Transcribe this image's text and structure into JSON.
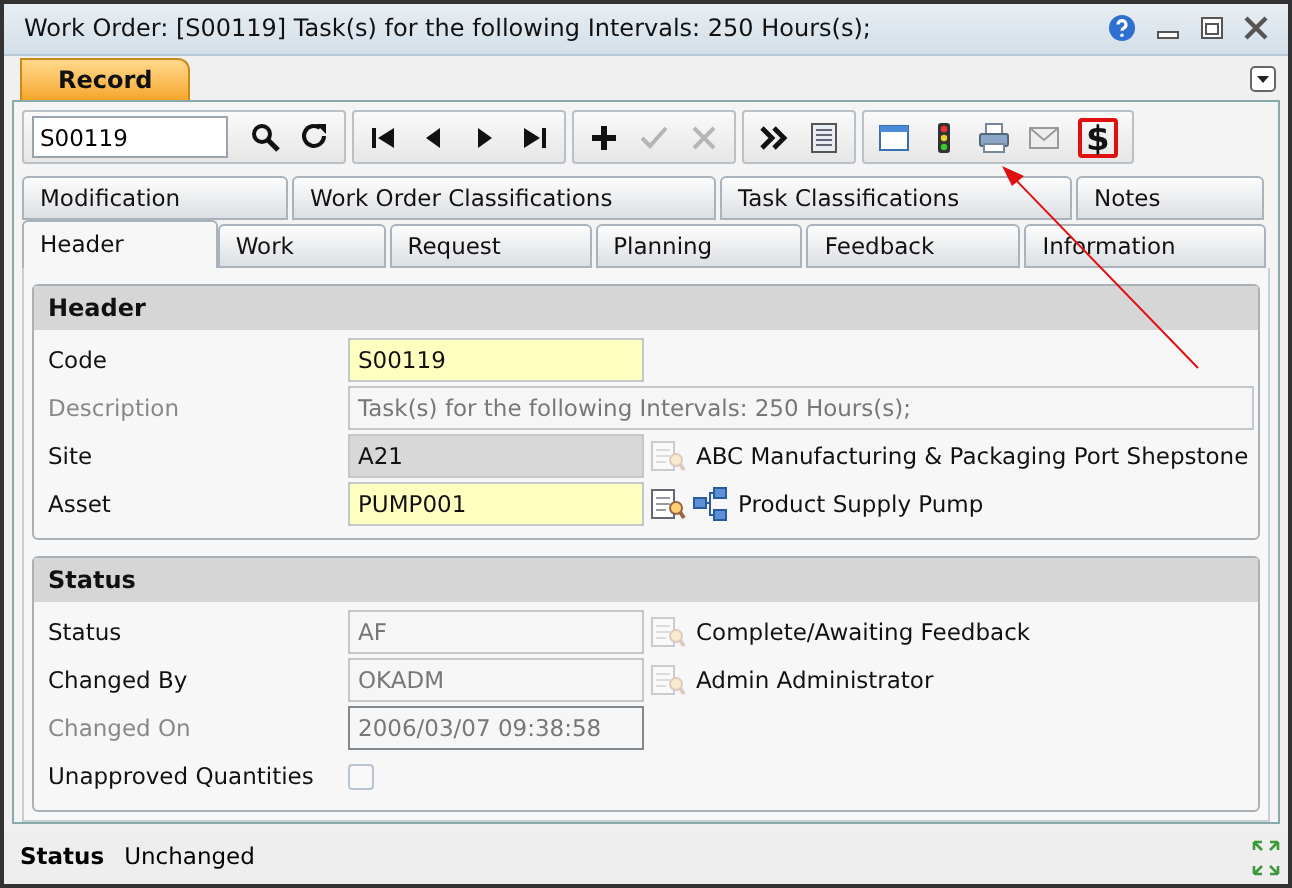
{
  "window": {
    "title": "Work Order: [S00119] Task(s) for the following Intervals: 250 Hours(s);"
  },
  "record_tab": {
    "label": "Record",
    "selected": true
  },
  "toolbar": {
    "search_value": "S00119",
    "groups": [
      [
        {
          "kind": "search"
        },
        {
          "kind": "refresh"
        }
      ],
      [
        {
          "kind": "first"
        },
        {
          "kind": "prev"
        },
        {
          "kind": "next"
        },
        {
          "kind": "last"
        }
      ],
      [
        {
          "kind": "add",
          "disabled": false
        },
        {
          "kind": "check",
          "disabled": true
        },
        {
          "kind": "cancel",
          "disabled": true
        }
      ],
      [
        {
          "kind": "more"
        },
        {
          "kind": "list"
        }
      ],
      [
        {
          "kind": "window"
        },
        {
          "kind": "traffic"
        },
        {
          "kind": "printer"
        },
        {
          "kind": "mail"
        },
        {
          "kind": "glyph",
          "glyph": "$",
          "highlighted": true
        }
      ]
    ]
  },
  "tabs_back": [
    {
      "label": "Modification",
      "selected": false
    },
    {
      "label": "Work Order Classifications",
      "selected": false
    },
    {
      "label": "Task Classifications",
      "selected": false
    },
    {
      "label": "Notes",
      "selected": false
    }
  ],
  "tabs_front": [
    {
      "label": "Header",
      "selected": true
    },
    {
      "label": "Work",
      "selected": false
    },
    {
      "label": "Request",
      "selected": false
    },
    {
      "label": "Planning",
      "selected": false
    },
    {
      "label": "Feedback",
      "selected": false
    },
    {
      "label": "Information",
      "selected": false
    }
  ],
  "sections": [
    {
      "title": "Header",
      "rows": [
        {
          "kind": "field",
          "label": "Code",
          "label_disabled": false,
          "value": "S00119",
          "required": true,
          "read_only": false,
          "disabled": false,
          "focused": false,
          "wide": false
        },
        {
          "kind": "field",
          "label": "Description",
          "label_disabled": true,
          "value": "Task(s) for the following Intervals: 250 Hours(s);",
          "required": false,
          "read_only": false,
          "disabled": true,
          "focused": false,
          "wide": true
        },
        {
          "kind": "field",
          "label": "Site",
          "label_disabled": false,
          "value": "A21",
          "required": false,
          "read_only": true,
          "disabled": false,
          "focused": false,
          "wide": false,
          "icons": [
            {
              "kind": "lookup",
              "disabled": true
            }
          ],
          "description": "ABC Manufacturing & Packaging Port Shepstone"
        },
        {
          "kind": "field",
          "label": "Asset",
          "label_disabled": false,
          "value": "PUMP001",
          "required": true,
          "read_only": false,
          "disabled": false,
          "focused": false,
          "wide": false,
          "icons": [
            {
              "kind": "lookup",
              "disabled": false
            },
            {
              "kind": "tree",
              "disabled": false
            }
          ],
          "description": "Product Supply Pump"
        }
      ]
    },
    {
      "title": "Status",
      "rows": [
        {
          "kind": "field",
          "label": "Status",
          "label_disabled": false,
          "value": "AF",
          "required": false,
          "read_only": false,
          "disabled": true,
          "focused": false,
          "wide": false,
          "icons": [
            {
              "kind": "lookup",
              "disabled": true
            }
          ],
          "description": "Complete/Awaiting Feedback"
        },
        {
          "kind": "field",
          "label": "Changed By",
          "label_disabled": false,
          "value": "OKADM",
          "required": false,
          "read_only": false,
          "disabled": true,
          "focused": false,
          "wide": false,
          "icons": [
            {
              "kind": "lookup",
              "disabled": true
            }
          ],
          "description": "Admin Administrator"
        },
        {
          "kind": "field",
          "label": "Changed On",
          "label_disabled": true,
          "value": "2006/03/07 09:38:58",
          "required": false,
          "read_only": false,
          "disabled": true,
          "focused": true,
          "wide": false
        },
        {
          "kind": "checkbox",
          "label": "Unapproved Quantities",
          "label_disabled": false,
          "checked": false
        }
      ]
    }
  ],
  "status_bar": {
    "label": "Status",
    "value": "Unchanged"
  }
}
